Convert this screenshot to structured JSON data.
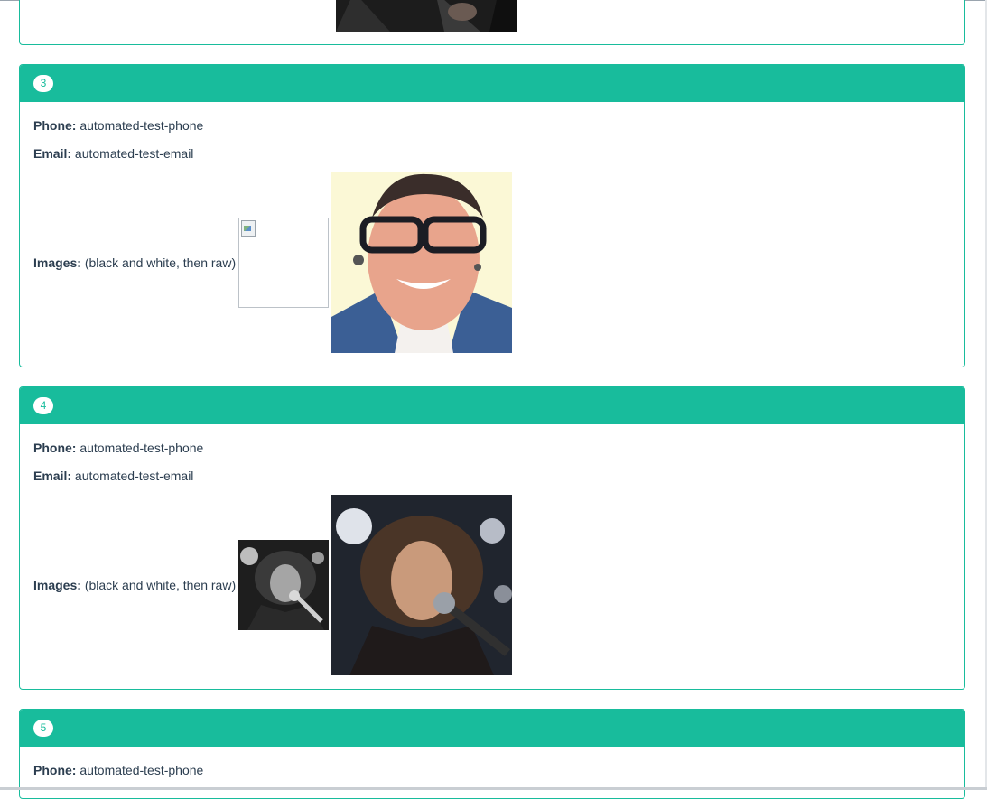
{
  "records": [
    {
      "number": "3",
      "phone_label": "Phone:",
      "phone": "automated-test-phone",
      "email_label": "Email:",
      "email": "automated-test-email",
      "images_label": "Images:",
      "images_note": "(black and white, then raw)"
    },
    {
      "number": "4",
      "phone_label": "Phone:",
      "phone": "automated-test-phone",
      "email_label": "Email:",
      "email": "automated-test-email",
      "images_label": "Images:",
      "images_note": "(black and white, then raw)"
    },
    {
      "number": "5",
      "phone_label": "Phone:",
      "phone": "automated-test-phone"
    }
  ],
  "colors": {
    "accent": "#18bc9c",
    "text": "#2c3e50"
  }
}
